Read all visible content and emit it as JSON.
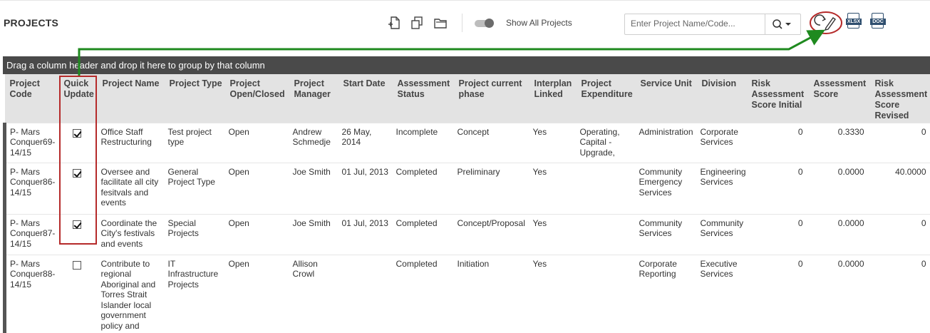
{
  "header": {
    "title": "PROJECTS",
    "show_all_label": "Show All Projects",
    "search_placeholder": "Enter Project Name/Code...",
    "xlsx_label": "XLSX",
    "doc_label": "DOC"
  },
  "icons": {
    "new_project": "new-file-icon",
    "copy": "copy-icon",
    "folder": "folder-icon",
    "search": "search-icon",
    "dropdown": "chevron-down-icon",
    "quick_update": "refresh-edit-icon"
  },
  "colors": {
    "group_bar": "#4a4a4a",
    "header_bg": "#e3e3e3",
    "annotation_box": "#b52a2a",
    "annotation_arrow": "#1f8a1f",
    "file_badge": "#2f4f6f"
  },
  "grid": {
    "group_hint": "Drag a column header and drop it here to group by that column",
    "columns": [
      {
        "label": "Project Code"
      },
      {
        "label": "Quick Update"
      },
      {
        "label": "Project Name"
      },
      {
        "label": "Project Type"
      },
      {
        "label": "Project Open/Closed"
      },
      {
        "label": "Project Manager"
      },
      {
        "label": "Start Date"
      },
      {
        "label": "Assessment Status"
      },
      {
        "label": "Project current phase"
      },
      {
        "label": "Interplan Linked"
      },
      {
        "label": "Project Expenditure"
      },
      {
        "label": "Service Unit"
      },
      {
        "label": "Division"
      },
      {
        "label": "Risk Assessment Score Initial"
      },
      {
        "label": "Assessment Score"
      },
      {
        "label": "Risk Assessment Score Revised"
      }
    ],
    "rows": [
      {
        "code": "P- Mars Conquer69-14/15",
        "quick_update": true,
        "name": "Office Staff Restructuring",
        "type": "Test project type",
        "open_closed": "Open",
        "manager": "Andrew Schmedje",
        "start_date": "26 May, 2014",
        "assessment_status": "Incomplete",
        "phase": "Concept",
        "interplan": "Yes",
        "expenditure": "Operating, Capital - Upgrade,",
        "service_unit": "Administration",
        "division": "Corporate Services",
        "risk_initial": "0",
        "assessment_score": "0.3330",
        "risk_revised": "0"
      },
      {
        "code": "P- Mars Conquer86-14/15",
        "quick_update": true,
        "name": "Oversee and facilitate all city fesitvals and events",
        "type": "General Project Type",
        "open_closed": "Open",
        "manager": "Joe Smith",
        "start_date": "01 Jul, 2013",
        "assessment_status": "Completed",
        "phase": "Preliminary",
        "interplan": "Yes",
        "expenditure": "",
        "service_unit": "Community Emergency Services",
        "division": "Engineering Services",
        "risk_initial": "0",
        "assessment_score": "0.0000",
        "risk_revised": "40.0000"
      },
      {
        "code": "P- Mars Conquer87-14/15",
        "quick_update": true,
        "name": "Coordinate the City's festivals and events",
        "type": "Special Projects",
        "open_closed": "Open",
        "manager": "Joe Smith",
        "start_date": "01 Jul, 2013",
        "assessment_status": "Completed",
        "phase": "Concept/Proposal",
        "interplan": "Yes",
        "expenditure": "",
        "service_unit": "Community Services",
        "division": "Community Services",
        "risk_initial": "0",
        "assessment_score": "0.0000",
        "risk_revised": "0"
      },
      {
        "code": "P- Mars Conquer88-14/15",
        "quick_update": false,
        "name": "Contribute to regional Aboriginal and Torres Strait Islander local government policy and",
        "type": "IT Infrastructure Projects",
        "open_closed": "Open",
        "manager": "Allison Crowl",
        "start_date": "",
        "assessment_status": "Completed",
        "phase": "Initiation",
        "interplan": "Yes",
        "expenditure": "",
        "service_unit": "Corporate Reporting",
        "division": "Executive Services",
        "risk_initial": "0",
        "assessment_score": "0.0000",
        "risk_revised": "0"
      }
    ]
  }
}
